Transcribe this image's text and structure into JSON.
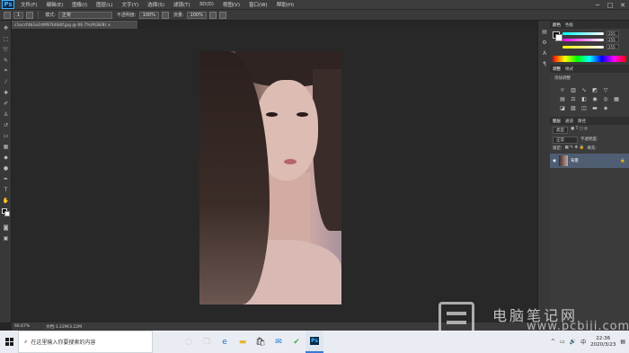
{
  "app": {
    "logo": "Ps"
  },
  "menu": [
    "文件(F)",
    "编辑(E)",
    "图像(I)",
    "图层(L)",
    "文字(Y)",
    "选择(S)",
    "滤镜(T)",
    "3D(D)",
    "视图(V)",
    "窗口(W)",
    "帮助(H)"
  ],
  "window_controls": {
    "minimize": "─",
    "maximize": "□",
    "close": "✕"
  },
  "options_bar": {
    "size": "1",
    "mode_label": "模式:",
    "mode_value": "正常",
    "opacity_label": "不透明度:",
    "opacity_value": "100%",
    "flow_label": "流量:",
    "flow_value": "100%"
  },
  "document_tab": {
    "title": "c1eccfdb1e2d9f87b0b0f.jpg @ 66.7%(RGB/8) ×"
  },
  "status_bar": {
    "zoom": "66.67%",
    "doc_info": "文档:3.22M/3.22M"
  },
  "color_panel": {
    "tabs": [
      "颜色",
      "色板"
    ],
    "r": "255",
    "g": "255",
    "b": "255"
  },
  "adjustments_panel": {
    "tabs": [
      "调整",
      "样式"
    ],
    "title": "添加调整"
  },
  "layers_panel": {
    "tabs": [
      "图层",
      "通道",
      "路径"
    ],
    "kind": "类型",
    "blend": "正常",
    "opacity_label": "不透明度:",
    "lock_label": "锁定:",
    "fill_label": "填充:",
    "layer_name": "背景"
  },
  "taskbar": {
    "search_placeholder": "在这里输入你要搜索的内容",
    "time": "22:36",
    "date": "2020/3/23",
    "ime": "中"
  },
  "watermark": {
    "text": "电脑笔记网",
    "url": "www.pcbiji.com"
  },
  "colors": {
    "ui_dark": "#282828",
    "panel": "#3b3b3b",
    "taskbar": "#e9edf3",
    "accent": "#3b78d8",
    "ps_blue": "#3fb5ff"
  },
  "icons": [
    "search-icon",
    "task-view-icon",
    "edge-icon",
    "folder-icon",
    "store-icon",
    "mail-icon",
    "photoshop-icon",
    "windows-logo-icon"
  ]
}
